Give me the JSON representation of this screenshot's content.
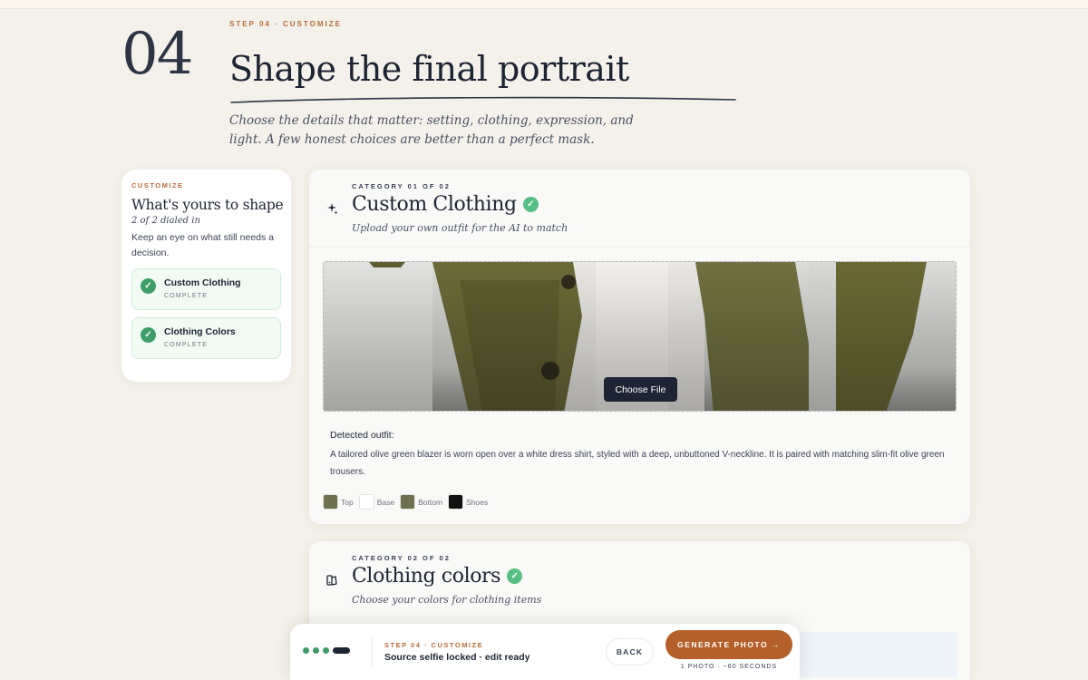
{
  "header": {
    "step_eyebrow": "STEP 04 · CUSTOMIZE",
    "step_number": "04",
    "title": "Shape the final portrait",
    "subtitle": "Choose the details that matter: setting, clothing, expression, and light. A few honest choices are better than a perfect mask."
  },
  "sidebar": {
    "eyebrow": "CUSTOMIZE",
    "title": "What's yours to shape",
    "progress": "2 of 2 dialed in",
    "description": "Keep an eye on what still needs a decision.",
    "items": [
      {
        "label": "Custom Clothing",
        "status": "COMPLETE"
      },
      {
        "label": "Clothing Colors",
        "status": "COMPLETE"
      }
    ]
  },
  "category1": {
    "eyebrow": "CATEGORY 01 OF 02",
    "icon": "sparkles-icon",
    "title": "Custom Clothing",
    "subtitle": "Upload your own outfit for the AI to match",
    "choose_file_label": "Choose File",
    "detected_label": "Detected outfit:",
    "detected_text": "A tailored olive green blazer is worn open over a white dress shirt, styled with a deep, unbuttoned V-neckline. It is paired with matching slim-fit olive green trousers.",
    "swatches": [
      {
        "label": "Top",
        "color": "#6e7150"
      },
      {
        "label": "Base",
        "color": "#ffffff"
      },
      {
        "label": "Bottom",
        "color": "#6e7150"
      },
      {
        "label": "Shoes",
        "color": "#111111"
      }
    ]
  },
  "category2": {
    "eyebrow": "CATEGORY 02 OF 02",
    "icon": "palette-icon",
    "title": "Clothing colors",
    "subtitle": "Choose your colors for clothing items"
  },
  "bottom_bar": {
    "step": "STEP 04 · CUSTOMIZE",
    "status": "Source selfie locked · edit ready",
    "back_label": "BACK",
    "generate_label": "GENERATE PHOTO →",
    "generate_note": "1 PHOTO · ~60 SECONDS"
  },
  "colors": {
    "accent": "#b5602a",
    "success": "#3f9d68",
    "dark": "#1d2433",
    "background": "#f4f1ea"
  }
}
